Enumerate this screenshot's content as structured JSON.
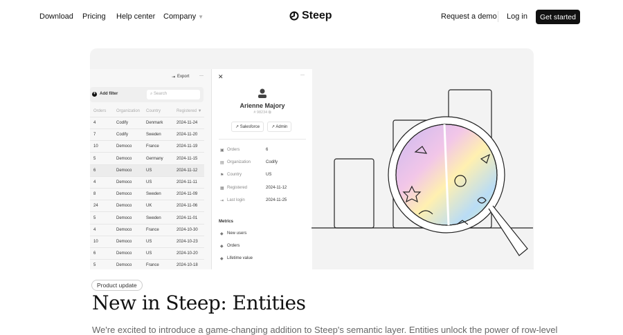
{
  "nav": {
    "links": [
      "Download",
      "Pricing",
      "Help center",
      "Company"
    ],
    "logo": "Steep",
    "request_demo": "Request a demo",
    "login": "Log in",
    "get_started": "Get started"
  },
  "table": {
    "export": "Export",
    "add_filter": "Add filter",
    "search_placeholder": "Search",
    "headers": [
      "Orders",
      "Organization",
      "Country",
      "Registered"
    ],
    "rows": [
      [
        "4",
        "Codify",
        "Denmark",
        "2024-11-24"
      ],
      [
        "7",
        "Codify",
        "Sweden",
        "2024-11-20"
      ],
      [
        "10",
        "Democo",
        "France",
        "2024-11-19"
      ],
      [
        "5",
        "Democo",
        "Germany",
        "2024-11-15"
      ],
      [
        "6",
        "Democo",
        "US",
        "2024-11-12"
      ],
      [
        "4",
        "Democo",
        "US",
        "2024-11-11"
      ],
      [
        "8",
        "Democo",
        "Sweden",
        "2024-11-09"
      ],
      [
        "24",
        "Democo",
        "UK",
        "2024-11-06"
      ],
      [
        "5",
        "Democo",
        "Sweden",
        "2024-11-01"
      ],
      [
        "4",
        "Democo",
        "France",
        "2024-10-30"
      ],
      [
        "10",
        "Democo",
        "US",
        "2024-10-23"
      ],
      [
        "6",
        "Democo",
        "US",
        "2024-10-20"
      ],
      [
        "5",
        "Democo",
        "France",
        "2024-10-18"
      ]
    ]
  },
  "detail": {
    "name": "Arienne Majory",
    "id": "# 98234",
    "salesforce": "Salesforce",
    "admin": "Admin",
    "fields": [
      {
        "label": "Orders",
        "value": "6"
      },
      {
        "label": "Organization",
        "value": "Codify"
      },
      {
        "label": "Country",
        "value": "US"
      },
      {
        "label": "Registered",
        "value": "2024-11-12"
      },
      {
        "label": "Last login",
        "value": "2024-11-25"
      }
    ],
    "metrics_title": "Metrics",
    "metrics": [
      "New users",
      "Orders",
      "Lifetime value"
    ]
  },
  "article": {
    "tag": "Product update",
    "title": "New in Steep: Entities",
    "intro": "We're excited to introduce a game-changing addition to Steep's semantic layer. Entities unlock the power of row-level"
  }
}
